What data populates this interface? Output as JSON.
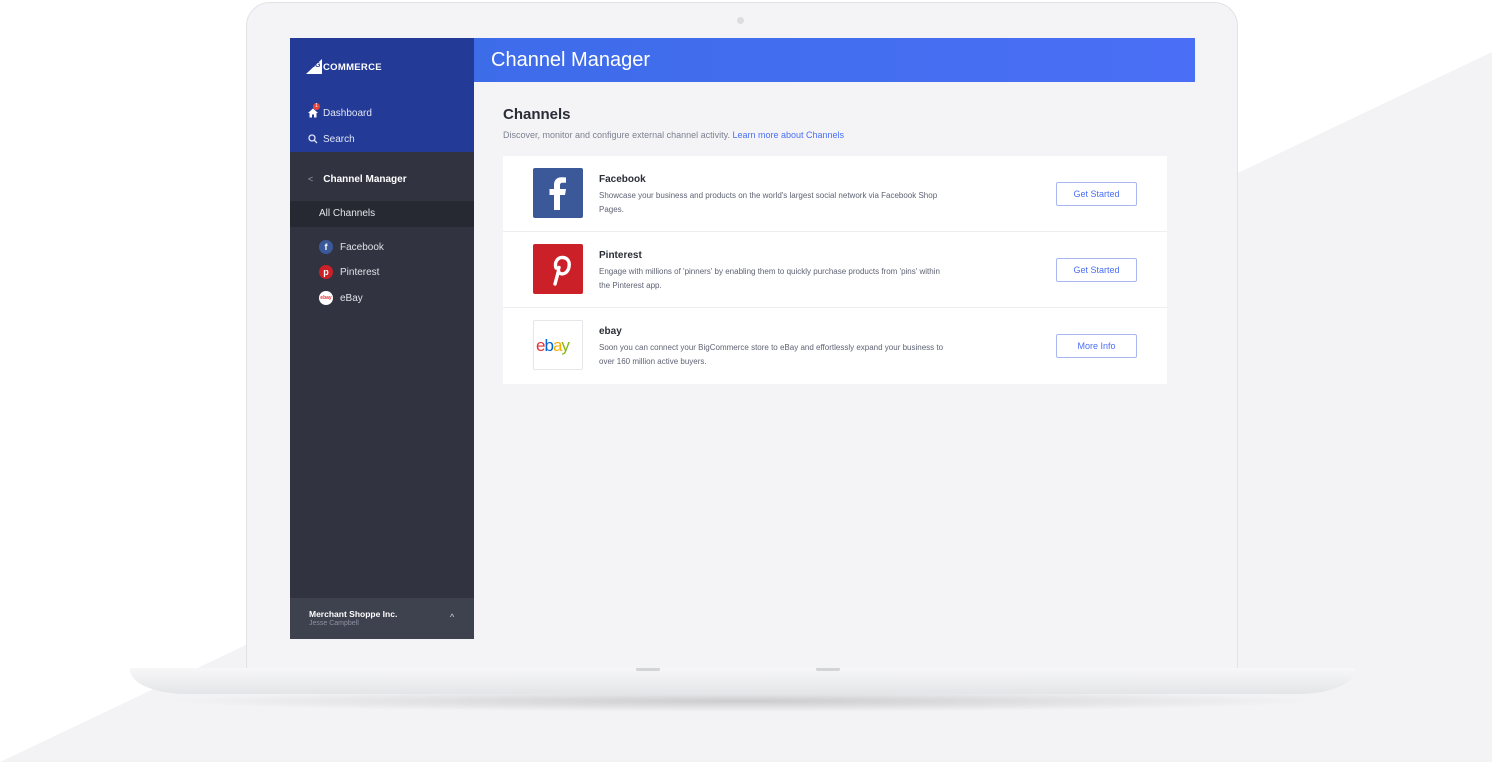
{
  "colors": {
    "header_blue": "#4a6ff6",
    "sidebar_dark": "#313440",
    "sidebar_top": "#233a96",
    "facebook": "#3b5998",
    "pinterest": "#cb2027"
  },
  "brand": {
    "logo_big": "BIG",
    "logo_rest": "COMMERCE"
  },
  "nav": {
    "dashboard": {
      "label": "Dashboard",
      "icon": "home-icon",
      "badge": "1"
    },
    "search": {
      "label": "Search",
      "icon": "search-icon"
    }
  },
  "sidebar": {
    "section_title": "Channel Manager",
    "active_item": "All Channels",
    "channels": [
      {
        "label": "Facebook",
        "icon": "facebook-icon"
      },
      {
        "label": "Pinterest",
        "icon": "pinterest-icon"
      },
      {
        "label": "eBay",
        "icon": "ebay-icon"
      }
    ],
    "merchant": {
      "store": "Merchant Shoppe Inc.",
      "user": "Jesse Campbell"
    }
  },
  "header": {
    "title": "Channel Manager"
  },
  "main": {
    "title": "Channels",
    "subtitle": "Discover, monitor and configure external channel activity.",
    "learn_link": "Learn more about Channels",
    "rows": [
      {
        "name": "Facebook",
        "desc": "Showcase your business and products on the world's largest social network via Facebook Shop Pages.",
        "button": "Get Started"
      },
      {
        "name": "Pinterest",
        "desc": "Engage with millions of 'pinners' by enabling them to quickly purchase products from 'pins' within the Pinterest app.",
        "button": "Get Started"
      },
      {
        "name": "ebay",
        "desc": "Soon you can connect your BigCommerce store to eBay and effortlessly expand your business to over 160 million active buyers.",
        "button": "More Info"
      }
    ]
  }
}
